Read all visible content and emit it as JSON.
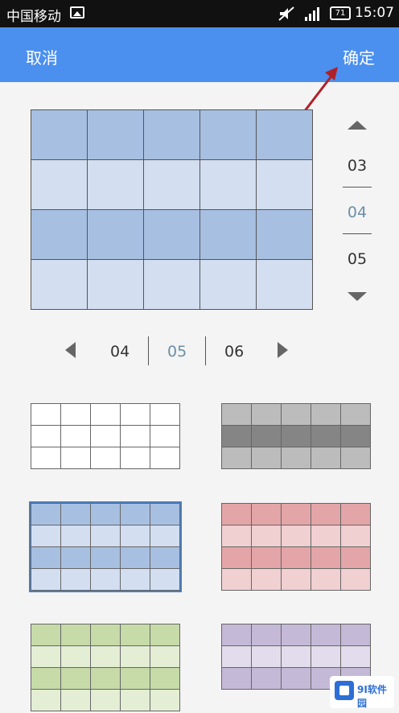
{
  "status_bar": {
    "carrier": "中国移动",
    "battery": "71",
    "time": "15:07",
    "icons": [
      "picture-icon",
      "mute-icon",
      "signal-icon",
      "battery-icon"
    ]
  },
  "app_bar": {
    "cancel_label": "取消",
    "confirm_label": "确定",
    "color": "#4b90ee"
  },
  "row_picker": {
    "values": [
      "03",
      "04",
      "05"
    ],
    "selected": "04"
  },
  "col_picker": {
    "values": [
      "04",
      "05",
      "06"
    ],
    "selected": "05"
  },
  "preview": {
    "rows": 4,
    "cols": 5,
    "style": "blue"
  },
  "styles": [
    {
      "name": "white",
      "header": "#ffffff",
      "band": "#ffffff",
      "line": "#666666"
    },
    {
      "name": "gray",
      "header": "#b9b9b9",
      "band": "#8a8a8a",
      "line": "#555555"
    },
    {
      "name": "blue",
      "header": "#a7bfe1",
      "band": "#d3def0",
      "line": "#555555",
      "selected": true
    },
    {
      "name": "red",
      "header": "#e3a5a7",
      "band": "#f0d0d1",
      "line": "#777777"
    },
    {
      "name": "green",
      "header": "#c6dba8",
      "band": "#e4eed5",
      "line": "#777777"
    },
    {
      "name": "purple",
      "header": "#c5b9d8",
      "band": "#e2dcec",
      "line": "#777777"
    }
  ],
  "watermark": {
    "text": "9I软件园"
  }
}
